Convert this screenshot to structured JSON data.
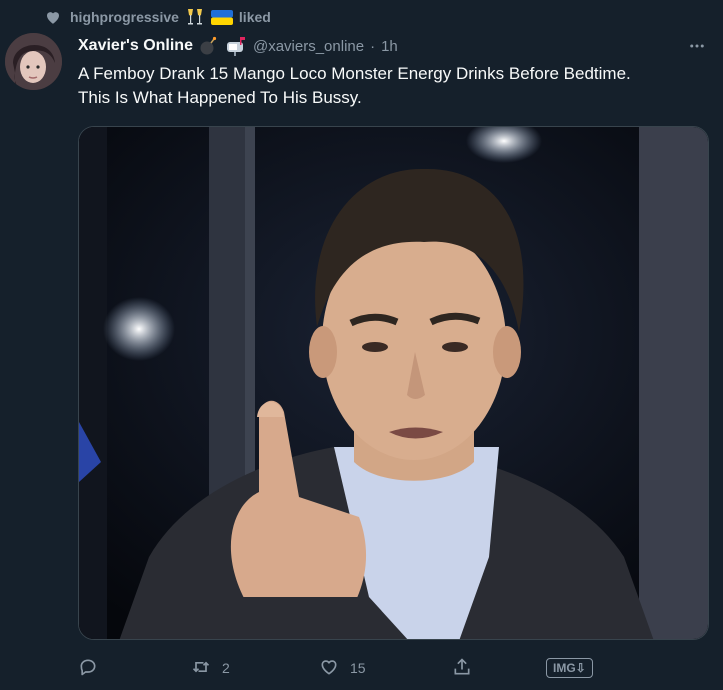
{
  "context": {
    "user": "highprogressive",
    "action": "liked"
  },
  "tweet": {
    "display_name": "Xavier's Online",
    "handle": "@xaviers_online",
    "separator": "·",
    "time": "1h",
    "text_line1": "A Femboy Drank 15 Mango Loco Monster Energy Drinks Before Bedtime.",
    "text_line2": "This Is What Happened To His Bussy."
  },
  "actions": {
    "reply_count": "",
    "retweet_count": "2",
    "like_count": "15",
    "img_label": "IMG⇩"
  },
  "colors": {
    "background": "#15202b",
    "secondary_text": "#8b98a5",
    "primary_text": "#f7f9f9",
    "border": "#38444d"
  },
  "icons": [
    "heart-icon",
    "champagne-emoji",
    "ukraine-flag-emoji",
    "bomb-emoji",
    "mailbox-emoji",
    "more-icon",
    "reply-icon",
    "retweet-icon",
    "like-icon",
    "share-icon"
  ]
}
